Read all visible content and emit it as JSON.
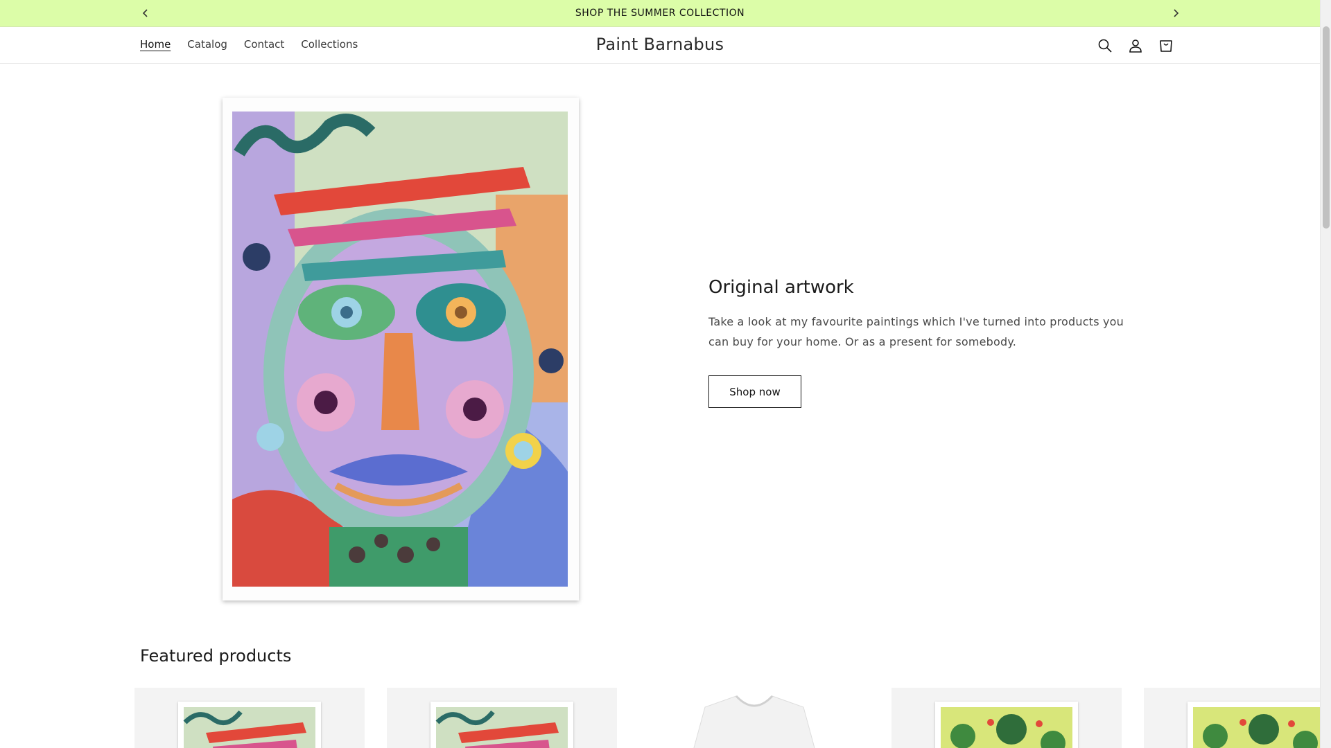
{
  "announcement": {
    "text": "SHOP THE SUMMER COLLECTION",
    "prev_icon": "chevron-left-icon",
    "next_icon": "chevron-right-icon"
  },
  "header": {
    "logo": "Paint Barnabus",
    "nav": [
      {
        "label": "Home",
        "active": true
      },
      {
        "label": "Catalog",
        "active": false
      },
      {
        "label": "Contact",
        "active": false
      },
      {
        "label": "Collections",
        "active": false
      }
    ],
    "icons": [
      "search-icon",
      "account-icon",
      "cart-icon"
    ]
  },
  "hero": {
    "title": "Original artwork",
    "description": "Take a look at my favourite paintings which I've turned into products you can buy for your home. Or as a present for somebody.",
    "button": "Shop now"
  },
  "featured": {
    "title": "Featured products",
    "products": [
      {
        "image": "face-painting-print"
      },
      {
        "image": "face-painting-print"
      },
      {
        "image": "white-t-shirt"
      },
      {
        "image": "green-plant-painting-print"
      },
      {
        "image": "green-plant-painting-print"
      }
    ]
  },
  "colors": {
    "announcement_bg": "#dcfda8",
    "text": "#121212"
  }
}
